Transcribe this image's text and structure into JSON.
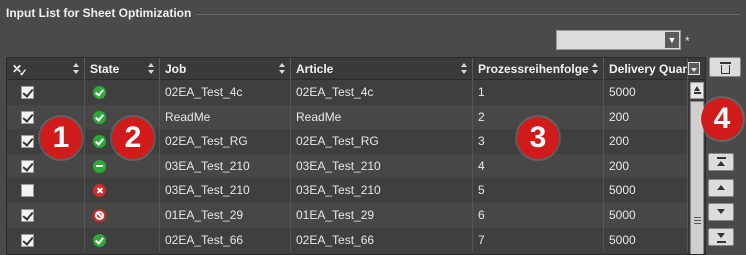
{
  "panel": {
    "title": "Input List for Sheet Optimization",
    "filter_value": "",
    "required_mark": "*"
  },
  "grid": {
    "columns": [
      {
        "label": ""
      },
      {
        "label": "State"
      },
      {
        "label": "Job"
      },
      {
        "label": "Article"
      },
      {
        "label": "Prozessreihenfolge"
      },
      {
        "label": "Delivery Quan"
      }
    ],
    "rows": [
      {
        "checked": true,
        "state": "ok",
        "job": "02EA_Test_4c",
        "article": "02EA_Test_4c",
        "order": "1",
        "delivery": "5000"
      },
      {
        "checked": true,
        "state": "ok",
        "job": "ReadMe",
        "article": "ReadMe",
        "order": "2",
        "delivery": "200"
      },
      {
        "checked": true,
        "state": "ok",
        "job": "02EA_Test_RG",
        "article": "02EA_Test_RG",
        "order": "3",
        "delivery": "200"
      },
      {
        "checked": true,
        "state": "partial",
        "job": "03EA_Test_210",
        "article": "03EA_Test_210",
        "order": "4",
        "delivery": "200"
      },
      {
        "checked": false,
        "state": "error",
        "job": "03EA_Test_210",
        "article": "03EA_Test_210",
        "order": "5",
        "delivery": "5000"
      },
      {
        "checked": true,
        "state": "blocked",
        "job": "01EA_Test_29",
        "article": "01EA_Test_29",
        "order": "6",
        "delivery": "5000"
      },
      {
        "checked": true,
        "state": "ok",
        "job": "02EA_Test_66",
        "article": "02EA_Test_66",
        "order": "7",
        "delivery": "5000"
      }
    ]
  },
  "callouts": [
    "1",
    "2",
    "3",
    "4"
  ],
  "icons": {
    "select_all": "select-all-icon",
    "column_chooser": "column-chooser-icon",
    "delete": "trash-icon",
    "move_top": "move-top-icon",
    "move_up": "move-up-icon",
    "move_down": "move-down-icon",
    "move_bottom": "move-bottom-icon"
  },
  "colors": {
    "state_ok": "#2fa83a",
    "state_error": "#d62a2a",
    "callout": "#d11a1a"
  }
}
